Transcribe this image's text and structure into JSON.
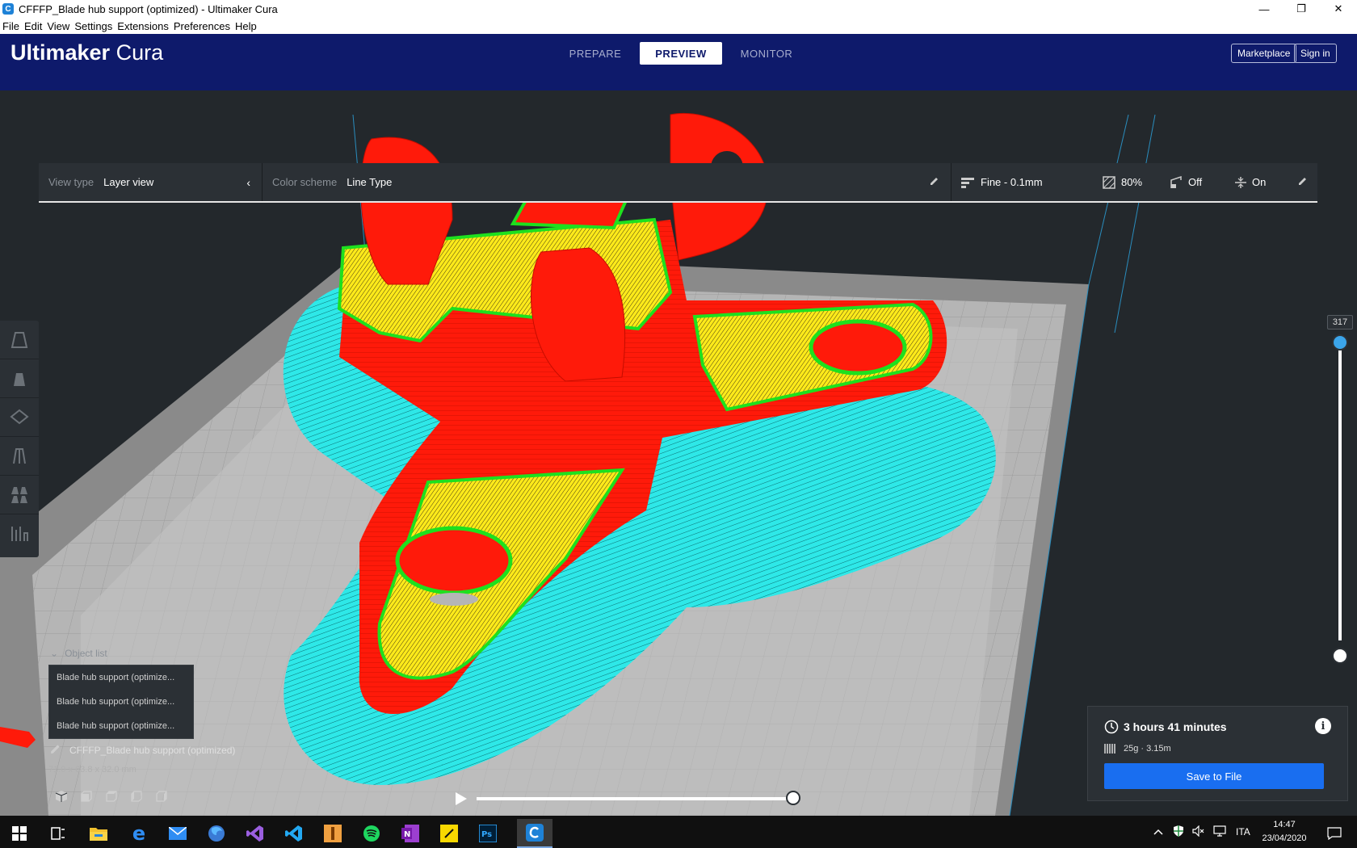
{
  "window": {
    "title": "CFFFP_Blade hub support (optimized) - Ultimaker Cura",
    "app_icon_letter": "C",
    "minimize": "—",
    "restore": "❐",
    "close": "✕"
  },
  "menu": [
    "File",
    "Edit",
    "View",
    "Settings",
    "Extensions",
    "Preferences",
    "Help"
  ],
  "header": {
    "brand_bold": "Ultimaker",
    "brand_light": "Cura",
    "tabs": [
      "PREPARE",
      "PREVIEW",
      "MONITOR"
    ],
    "active_tab": "PREVIEW",
    "marketplace": "Marketplace",
    "sign_in": "Sign in"
  },
  "view_panel": {
    "view_type_label": "View type",
    "view_type_value": "Layer view",
    "color_scheme_label": "Color scheme",
    "color_scheme_value": "Line Type",
    "profile": "Fine - 0.1mm",
    "infill": "80%",
    "support": "Off",
    "adhesion": "On"
  },
  "layer_slider": {
    "current_layer": "317"
  },
  "object_list": {
    "heading": "Object list",
    "items": [
      "Blade hub support (optimize...",
      "Blade hub support (optimize...",
      "Blade hub support (optimize..."
    ]
  },
  "job": {
    "name": "CFFFP_Blade hub support (optimized)",
    "dimensions": "71.0 x 63.8 x 32.0 mm"
  },
  "print_info": {
    "time": "3 hours 41 minutes",
    "material": "25g · 3.15m",
    "save_label": "Save to File"
  },
  "taskbar": {
    "language": "ITA",
    "time": "14:47",
    "date": "23/04/2020"
  },
  "colors": {
    "header_bg": "#0e1a6b",
    "wall_red": "#ff1a0a",
    "infill_yellow": "#ffea1a",
    "skin_green": "#1ee01e",
    "skirt_cyan": "#2ee8e8",
    "primary_blue": "#196ef0"
  }
}
